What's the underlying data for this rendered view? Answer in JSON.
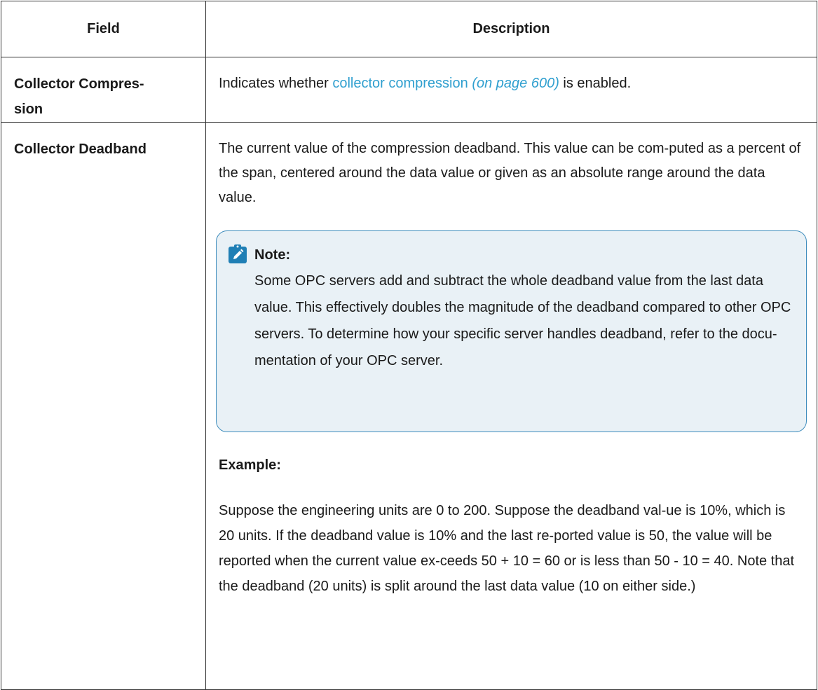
{
  "table": {
    "headers": {
      "field": "Field",
      "description": "Description"
    },
    "rows": [
      {
        "field": "Collector Compres-\nsion",
        "desc_prefix": "Indicates whether ",
        "link_text": "collector compression",
        "link_ref": "(on page 600)",
        "desc_suffix": " is enabled."
      },
      {
        "field": "Collector Deadband",
        "description": "The current value of the compression deadband. This value can be com-puted as a percent of the span, centered around the data value or given as an absolute range around the data value.",
        "note": {
          "title": "Note:",
          "body": "Some OPC servers add and subtract the whole deadband value from the last data value. This effectively doubles the magnitude of the deadband compared to other OPC servers. To determine how your specific server handles deadband, refer to the docu-mentation of your OPC server.",
          "icon": "pencil-clipboard-icon"
        },
        "example_title": "Example:",
        "example_body": "Suppose the engineering units are 0 to 200. Suppose the deadband val-ue is 10%, which is 20 units. If the deadband value is 10% and the last re-ported value is 50, the value will be reported when the current value ex-ceeds 50 + 10 = 60 or is less than 50 - 10 = 40. Note that the deadband (20 units) is split around the last data value (10 on either side.)"
      }
    ]
  },
  "colors": {
    "link": "#2f9fcf",
    "note_background": "#e9f1f6",
    "note_border": "#3f8dbd",
    "note_icon": "#1f7fb5"
  }
}
